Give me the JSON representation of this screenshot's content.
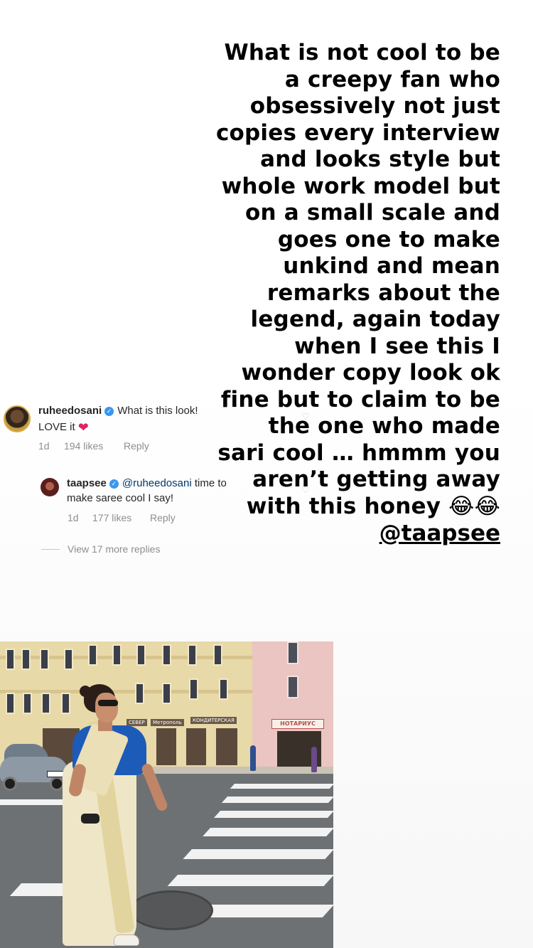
{
  "story": {
    "text": "What is not cool to be\na creepy fan who\nobsessively not just\ncopies every interview\nand looks style but\nwhole work model but\non a small scale and\ngoes one to  make\nunkind and mean\nremarks about the\nlegend, again today\nwhen I see this I\nwonder copy look ok\nfine but to claim to be\nthe one who made\nsari cool … hmmm you\naren’t getting away\nwith this honey 😂😂",
    "mention": "@taapsee"
  },
  "comments": [
    {
      "username": "ruheedosani",
      "text": "What is this look!",
      "text_line2": "LOVE it",
      "emoji": "❤",
      "age": "1d",
      "likes": "194 likes",
      "reply_label": "Reply"
    },
    {
      "username": "taapsee",
      "mention": "@ruheedosani",
      "text": "time to",
      "text_line2": "make saree cool I say!",
      "age": "1d",
      "likes": "177 likes",
      "reply_label": "Reply"
    }
  ],
  "view_more": "View 17 more replies",
  "icons": {
    "verified": "verified-badge-icon",
    "like": "heart-outline-icon"
  },
  "photo": {
    "signs": [
      "СЕВЕР",
      "Метрополь",
      "КОНДИТЕРСКАЯ"
    ],
    "notary_sign": "НОТАРИУС"
  },
  "colors": {
    "verified": "#3897f0",
    "mention": "#00376b",
    "meta": "#8e8e8e",
    "heart": "#e0245e"
  }
}
